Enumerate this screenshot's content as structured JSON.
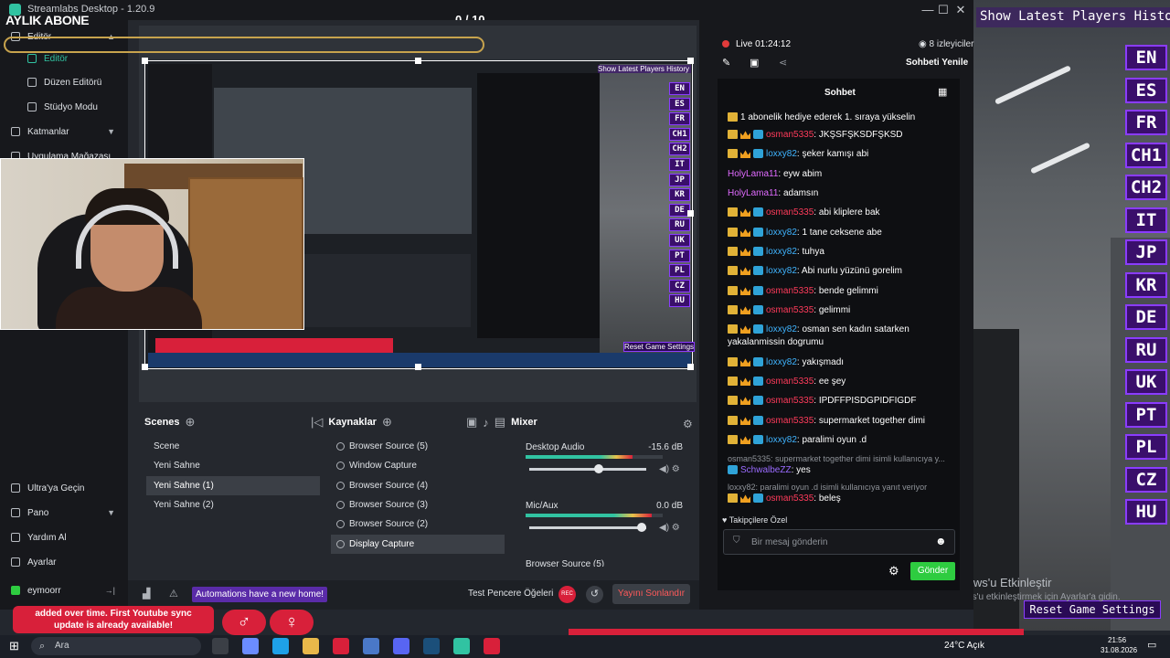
{
  "app": {
    "title": "Streamlabs Desktop - 1.20.9",
    "scene_counter": "0 / 10"
  },
  "overlay": {
    "monthly_sub": "AYLIK ABONE",
    "game_title": "Show Latest Players History",
    "reset_game": "Reset Game Settings",
    "red_banner_line1": "added over time. First Youtube sync",
    "red_banner_line2": "update is already available!"
  },
  "languages": [
    "EN",
    "ES",
    "FR",
    "CH1",
    "CH2",
    "IT",
    "JP",
    "KR",
    "DE",
    "RU",
    "UK",
    "PT",
    "PL",
    "CZ",
    "HU"
  ],
  "sidebar": {
    "editor": "Editör",
    "editor_sub": "Editör",
    "layout_editor": "Düzen Editörü",
    "studio_mode": "Stüdyo Modu",
    "layers": "Katmanlar",
    "app_store": "Uygulama Mağazası",
    "ultra": "Ultra'ya Geçin",
    "pano": "Pano",
    "help": "Yardım Al",
    "settings": "Ayarlar",
    "user": "eymoorr"
  },
  "scenes": {
    "title": "Scenes",
    "items": [
      "Scene",
      "Yeni Sahne",
      "Yeni Sahne (1)",
      "Yeni Sahne (2)"
    ],
    "selected": 2
  },
  "sources": {
    "title": "Kaynaklar",
    "items": [
      "Browser Source (5)",
      "Window Capture",
      "Browser Source (4)",
      "Browser Source (3)",
      "Browser Source (2)",
      "Display Capture"
    ],
    "selected": 5
  },
  "mixer": {
    "title": "Mixer",
    "channels": [
      {
        "name": "Desktop Audio",
        "db": "-15.6 dB",
        "level": 0.78,
        "volume": 0.6
      },
      {
        "name": "Mic/Aux",
        "db": "0.0 dB",
        "level": 0.92,
        "volume": 1.0
      },
      {
        "name": "Browser Source (5)",
        "db": "",
        "level": 0,
        "volume": 0
      }
    ]
  },
  "footer": {
    "automation": "Automations have a new home!",
    "test_windows": "Test Pencere Öğeleri",
    "rec": "REC",
    "end_stream": "Yayını Sonlandır"
  },
  "chat": {
    "live": "Live 01:24:12",
    "viewers": "8 izleyiciler",
    "refresh": "Sohbeti Yenile",
    "title": "Sohbet",
    "pinned": "1 abonelik hediye ederek 1. sıraya yükselin",
    "messages": [
      {
        "user": "osman5335",
        "text": "JKŞSFŞKSDFŞKSD",
        "type": "osman",
        "badges": true
      },
      {
        "user": "loxxy82",
        "text": "şeker kamışı abi",
        "type": "loxxy",
        "badges": true
      },
      {
        "user": "HolyLama11",
        "text": "eyw abim",
        "type": "holy",
        "badges": false
      },
      {
        "user": "HolyLama11",
        "text": "adamsın",
        "type": "holy",
        "badges": false
      },
      {
        "user": "osman5335",
        "text": "abi kliplere bak",
        "type": "osman",
        "badges": true
      },
      {
        "user": "loxxy82",
        "text": "1 tane ceksene abe",
        "type": "loxxy",
        "badges": true
      },
      {
        "user": "loxxy82",
        "text": "tuhya",
        "type": "loxxy",
        "badges": true
      },
      {
        "user": "loxxy82",
        "text": "Abi nurlu yüzünü gorelim",
        "type": "loxxy",
        "badges": true
      },
      {
        "user": "osman5335",
        "text": "bende gelimmi",
        "type": "osman",
        "badges": true
      },
      {
        "user": "osman5335",
        "text": "gelimmi",
        "type": "osman",
        "badges": true
      },
      {
        "user": "loxxy82",
        "text": "osman sen kadın satarken",
        "type": "loxxy",
        "badges": true
      },
      {
        "user": "",
        "text": "yakalanmissin dogrumu",
        "type": "cont",
        "badges": false
      },
      {
        "user": "loxxy82",
        "text": "yakışmadı",
        "type": "loxxy",
        "badges": true
      },
      {
        "user": "osman5335",
        "text": "ee şey",
        "type": "osman",
        "badges": true
      },
      {
        "user": "osman5335",
        "text": "IPDFFPISDGPIDFIGDF",
        "type": "osman",
        "badges": true
      },
      {
        "user": "osman5335",
        "text": "supermarket together dimi",
        "type": "osman",
        "badges": true
      },
      {
        "user": "loxxy82",
        "text": "paralimi oyun .d",
        "type": "loxxy",
        "badges": true
      },
      {
        "user": "",
        "text": "osman5335: supermarket together dimi isimli kullanıcıya y...",
        "type": "reply",
        "badges": false
      },
      {
        "user": "SchwalbeZZ",
        "text": "yes",
        "type": "schwa",
        "badges": false
      },
      {
        "user": "",
        "text": "loxxy82: paralimi oyun .d isimli kullanıcıya yanıt veriyor",
        "type": "reply",
        "badges": false
      },
      {
        "user": "osman5335",
        "text": "beleş",
        "type": "osman",
        "badges": true
      }
    ],
    "follower_only": "Takipçilere Özel",
    "input_placeholder": "Bir mesaj gönderin",
    "send": "Gönder"
  },
  "windows": {
    "activate_title": "Windows'u Etkinleştir",
    "activate_sub": "Windows'u etkinleştirmek için Ayarlar'a gidin.",
    "search": "Ara",
    "weather": "24°C Açık",
    "time": "21:56",
    "date": "31.08.2026"
  },
  "colors": {
    "accent": "#31c3a2",
    "send": "#2ecc40",
    "live": "#e23b3b",
    "lang_bg": "#3a0f6b",
    "lang_border": "#8a3cff"
  }
}
